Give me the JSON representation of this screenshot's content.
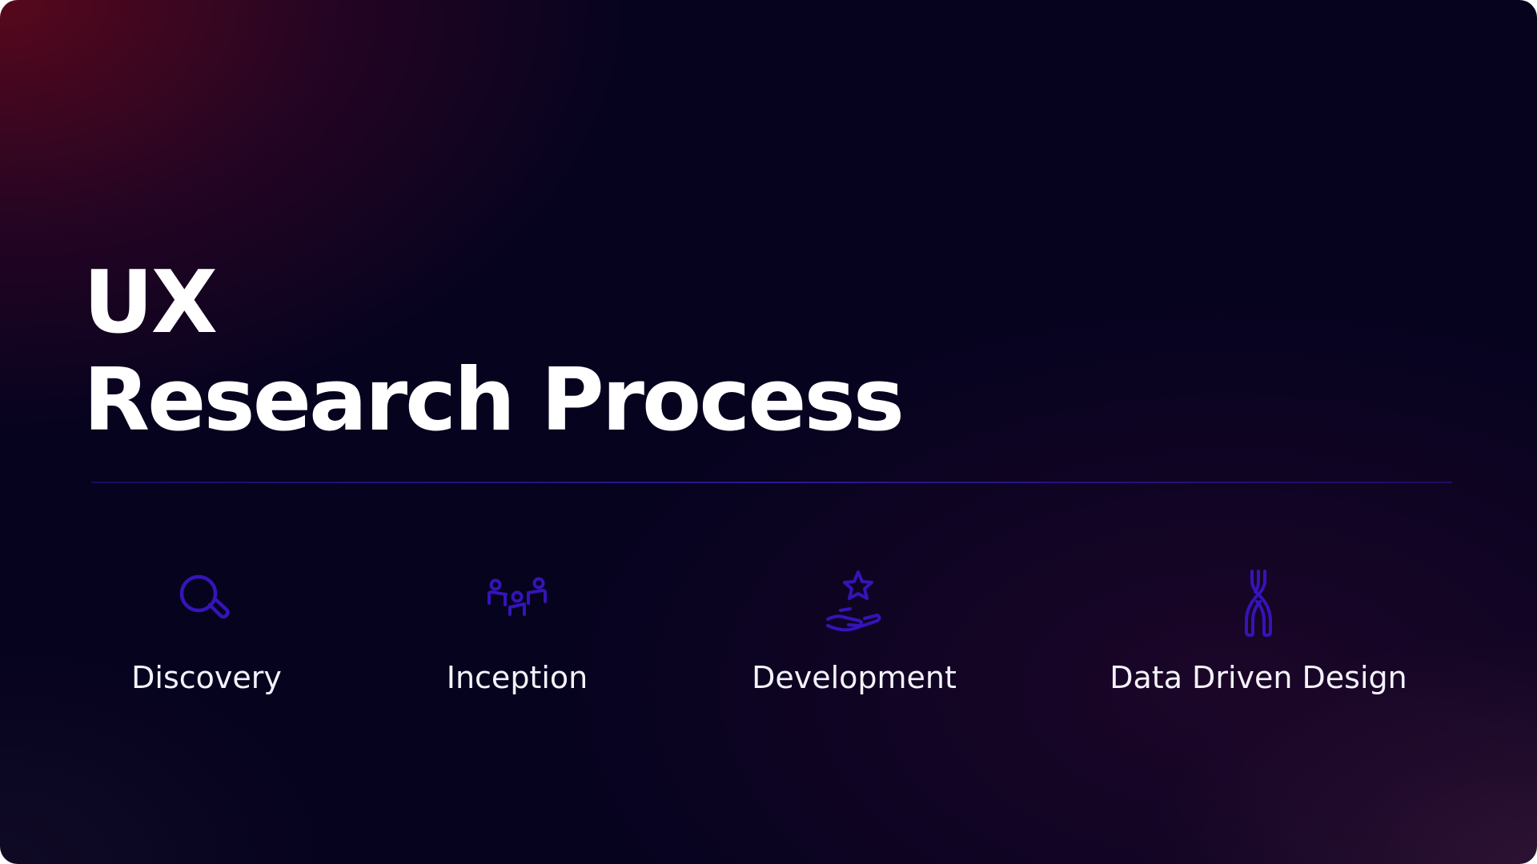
{
  "slide": {
    "title_line1": "UX",
    "title_line2": "Research Process",
    "steps": [
      {
        "label": "Discovery",
        "icon": "magnifying-glass-icon"
      },
      {
        "label": "Inception",
        "icon": "people-group-icon"
      },
      {
        "label": "Development",
        "icon": "hand-star-icon"
      },
      {
        "label": "Data Driven Design",
        "icon": "tongs-icon"
      }
    ]
  },
  "colors": {
    "background": "#06031f",
    "background_accent": "#5c081c",
    "icon": "#3514b8",
    "divider": "#2a1696",
    "text": "#ffffff"
  }
}
